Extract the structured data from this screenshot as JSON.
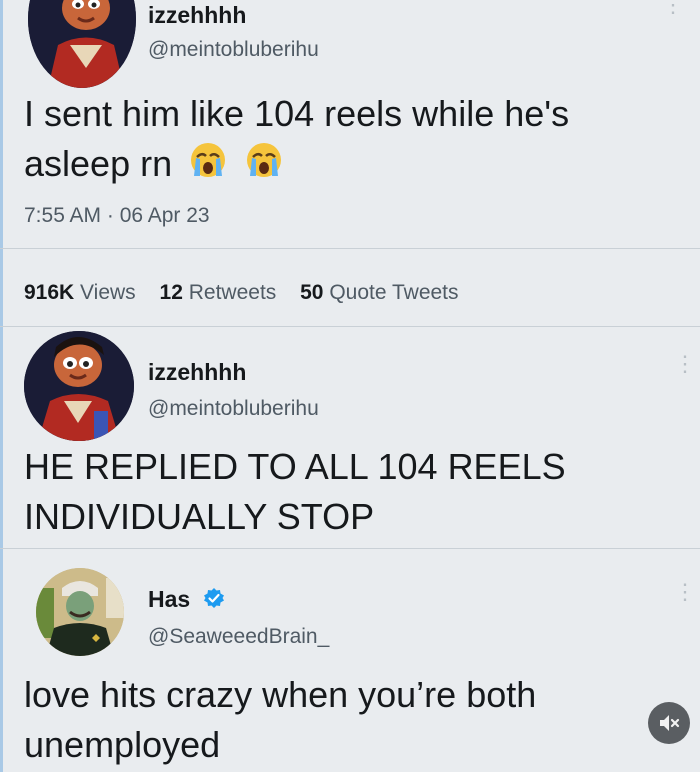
{
  "tweet1": {
    "name": "izzehhhh",
    "handle": "@meintobluberihu",
    "text_line1": "I sent him like 104 reels while he's",
    "text_line2": "asleep rn",
    "emoji_icons": [
      "loudly-crying-face-icon",
      "loudly-crying-face-icon"
    ],
    "timestamp": "7:55 AM · 06 Apr 23",
    "stats": {
      "views_count": "916K",
      "views_label": "Views",
      "retweets_count": "12",
      "retweets_label": "Retweets",
      "quotes_count": "50",
      "quotes_label": "Quote Tweets"
    }
  },
  "tweet2": {
    "name": "izzehhhh",
    "handle": "@meintobluberihu",
    "text_line1": "HE REPLIED TO ALL 104 REELS",
    "text_line2": "INDIVIDUALLY STOP"
  },
  "tweet3": {
    "name": "Has",
    "handle": "@SeaweeedBrain_",
    "text_line1": "love hits crazy when you’re both",
    "text_line2": "unemployed"
  },
  "colors": {
    "background": "#e9ecef",
    "text": "#16191c",
    "secondary_text": "#4f5a64",
    "verified": "#1d9bf0"
  },
  "mute_button": {
    "icon": "speaker-muted-icon"
  }
}
